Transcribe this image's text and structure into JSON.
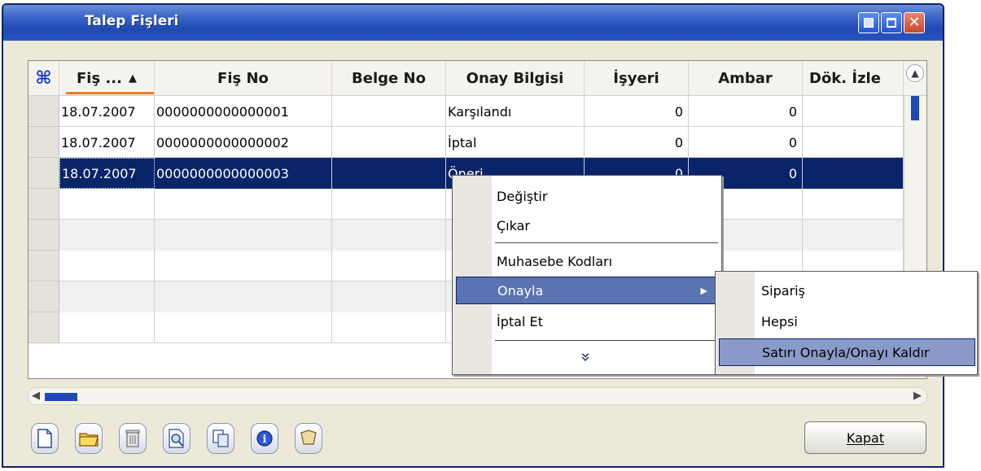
{
  "window": {
    "title": "Talep Fişleri"
  },
  "grid": {
    "columns": [
      "Fiş ...",
      "Fiş No",
      "Belge No",
      "Onay Bilgisi",
      "İşyeri",
      "Ambar",
      "Dök. İzle"
    ],
    "rows": [
      {
        "date": "18.07.2007",
        "fis_no": "0000000000000001",
        "belge_no": "",
        "onay": "Karşılandı",
        "isyeri": "0",
        "ambar": "0",
        "dok": ""
      },
      {
        "date": "18.07.2007",
        "fis_no": "0000000000000002",
        "belge_no": "",
        "onay": "İptal",
        "isyeri": "0",
        "ambar": "0",
        "dok": ""
      },
      {
        "date": "18.07.2007",
        "fis_no": "0000000000000003",
        "belge_no": "",
        "onay": "Öneri",
        "isyeri": "0",
        "ambar": "0",
        "dok": ""
      }
    ]
  },
  "context_menu": {
    "items": [
      "Değiştir",
      "Çıkar",
      "Muhasebe Kodları",
      "Onayla",
      "İptal Et"
    ],
    "more": "»"
  },
  "submenu": {
    "items": [
      "Sipariş",
      "Hepsi",
      "Satırı Onayla/Onayı Kaldır"
    ]
  },
  "toolbar": {
    "close_label": "Kapat"
  },
  "colors": {
    "selection": "#0a246a",
    "titlebar": "#1f49b3",
    "accent": "#f07a2c"
  }
}
